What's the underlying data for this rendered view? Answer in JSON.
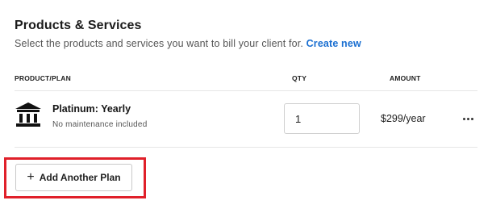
{
  "section": {
    "title": "Products & Services",
    "subtitle": "Select the products and services you want to bill your client for.",
    "create_link": "Create new"
  },
  "table": {
    "headers": [
      "PRODUCT/PLAN",
      "QTY",
      "AMOUNT"
    ],
    "rows": [
      {
        "icon": "bank-building-icon",
        "name": "Platinum: Yearly",
        "note": "No maintenance included",
        "qty": "1",
        "amount": "$299/year"
      }
    ]
  },
  "actions": {
    "add_plan_label": "Add Another Plan"
  },
  "colors": {
    "accent_link": "#1a6fd1",
    "highlight": "#e0202a"
  }
}
